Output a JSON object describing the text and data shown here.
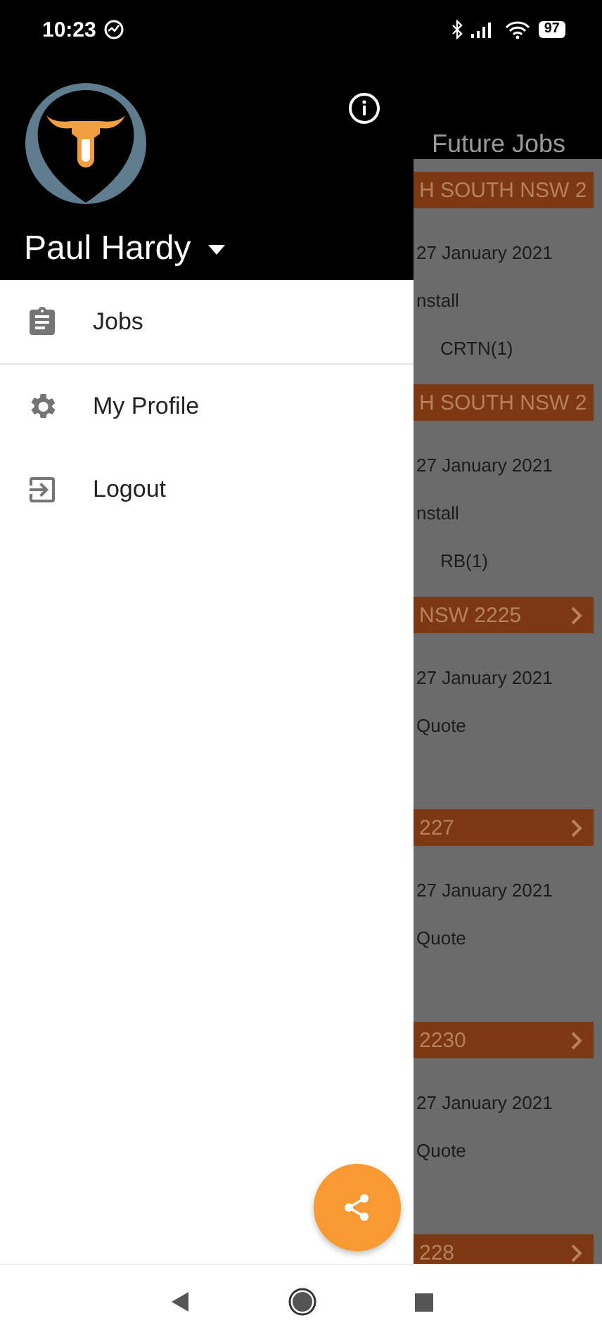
{
  "status_bar": {
    "time": "10:23",
    "battery": "97"
  },
  "drawer": {
    "user_name": "Paul Hardy",
    "items": [
      {
        "label": "Jobs"
      },
      {
        "label": "My Profile"
      },
      {
        "label": "Logout"
      }
    ]
  },
  "app_bar": {
    "title": "Future Jobs"
  },
  "jobs": [
    {
      "heading": "H SOUTH NSW 2",
      "date": "27 January 2021",
      "type": "nstall",
      "items": "CRTN(1)"
    },
    {
      "heading": "H SOUTH NSW 2",
      "date": "27 January 2021",
      "type": "nstall",
      "items": "RB(1)"
    },
    {
      "heading": "NSW 2225",
      "date": "27 January 2021",
      "type": "Quote"
    },
    {
      "heading": "227",
      "date": "27 January 2021",
      "type": "Quote"
    },
    {
      "heading": "2230",
      "date": "27 January 2021",
      "type": "Quote"
    },
    {
      "heading": "228"
    }
  ]
}
